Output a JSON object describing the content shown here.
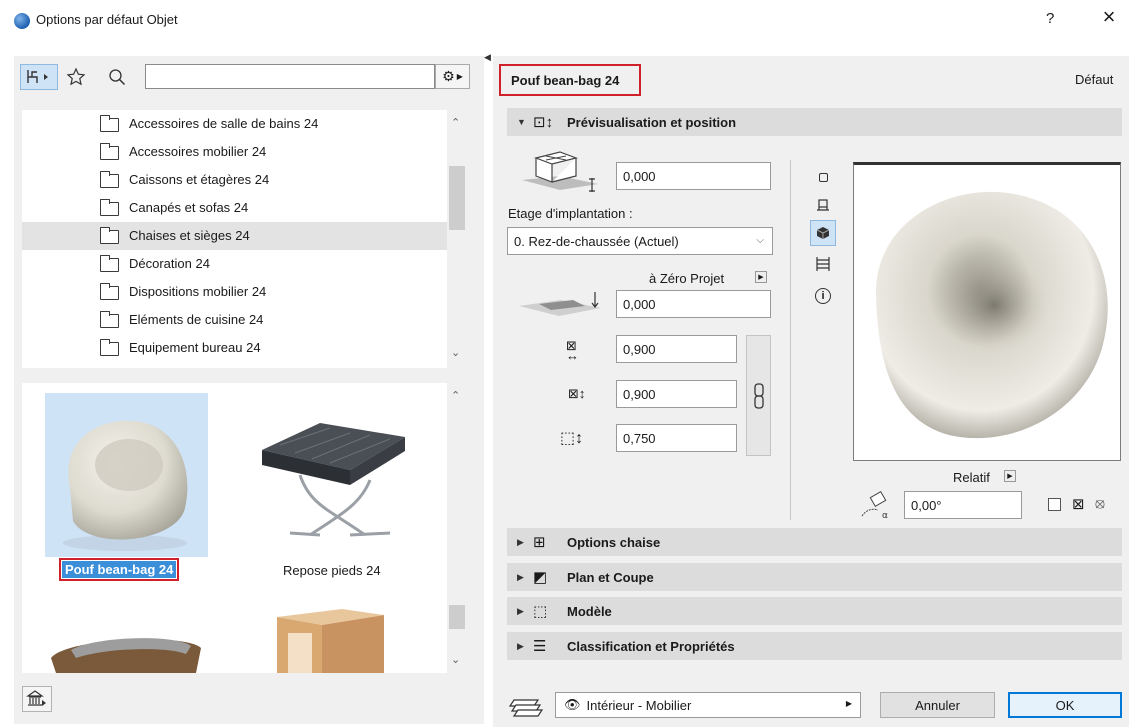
{
  "window": {
    "title": "Options par défaut Objet",
    "help_label": "?",
    "close_label": "×"
  },
  "library": {
    "search": {
      "value": "",
      "placeholder": ""
    },
    "folders": [
      {
        "label": "Accessoires de salle de bains 24",
        "selected": false
      },
      {
        "label": "Accessoires mobilier 24",
        "selected": false
      },
      {
        "label": "Caissons et étagères 24",
        "selected": false
      },
      {
        "label": "Canapés et sofas 24",
        "selected": false
      },
      {
        "label": "Chaises et sièges 24",
        "selected": true
      },
      {
        "label": "Décoration 24",
        "selected": false
      },
      {
        "label": "Dispositions mobilier 24",
        "selected": false
      },
      {
        "label": "Eléments de cuisine 24",
        "selected": false
      },
      {
        "label": "Equipement bureau 24",
        "selected": false
      }
    ],
    "thumbnails": [
      {
        "label": "Pouf bean-bag 24",
        "selected": true
      },
      {
        "label": "Repose pieds 24",
        "selected": false
      }
    ]
  },
  "header": {
    "object_name": "Pouf bean-bag 24",
    "preset_label": "Défaut"
  },
  "sections": {
    "preview": "Prévisualisation et position",
    "chair_options": "Options chaise",
    "plan_section": "Plan et Coupe",
    "model": "Modèle",
    "classification": "Classification et Propriétés"
  },
  "position": {
    "elevation_value": "0,000",
    "story_label": "Etage d'implantation :",
    "story_value": "0. Rez-de-chaussée (Actuel)",
    "zero_label": "à Zéro Projet",
    "zero_value": "0,000",
    "width_value": "0,900",
    "depth_value": "0,900",
    "height_value": "0,750",
    "relative_label": "Relatif",
    "angle_value": "0,00°"
  },
  "footer": {
    "layer_value": "Intérieur - Mobilier",
    "cancel_label": "Annuler",
    "ok_label": "OK"
  }
}
